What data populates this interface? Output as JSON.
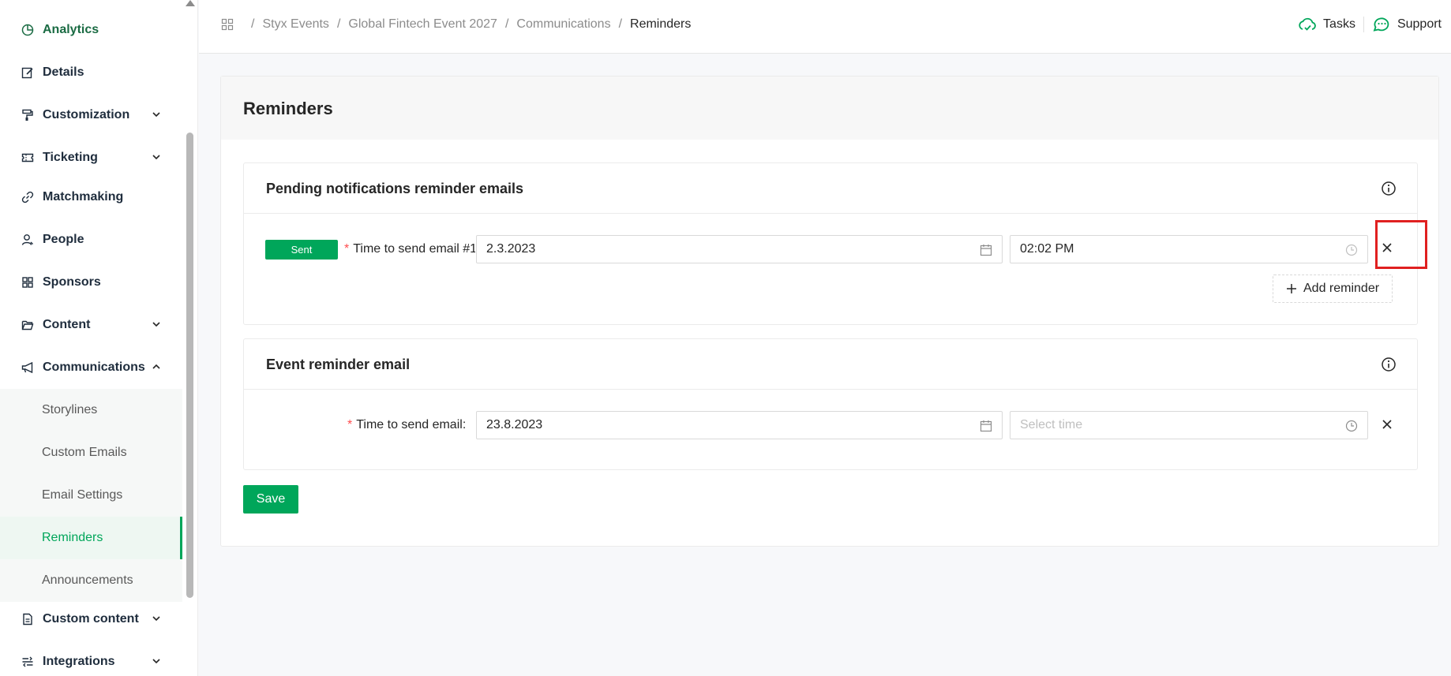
{
  "sidebar": {
    "items": [
      {
        "label": "Analytics",
        "icon": "pie-chart-icon"
      },
      {
        "label": "Details",
        "icon": "edit-icon"
      },
      {
        "label": "Customization",
        "icon": "paint-roller-icon"
      },
      {
        "label": "Ticketing",
        "icon": "ticket-icon"
      },
      {
        "label": "Matchmaking",
        "icon": "link-icon"
      },
      {
        "label": "People",
        "icon": "person-icon"
      },
      {
        "label": "Sponsors",
        "icon": "grid-icon"
      },
      {
        "label": "Content",
        "icon": "folder-icon"
      },
      {
        "label": "Communications",
        "icon": "megaphone-icon"
      },
      {
        "label": "Custom content",
        "icon": "document-icon"
      },
      {
        "label": "Integrations",
        "icon": "integrations-icon"
      }
    ],
    "sub_items": [
      {
        "label": "Storylines"
      },
      {
        "label": "Custom Emails"
      },
      {
        "label": "Email Settings"
      },
      {
        "label": "Reminders"
      },
      {
        "label": "Announcements"
      }
    ]
  },
  "breadcrumb": [
    "Styx Events",
    "Global Fintech Event 2027",
    "Communications",
    "Reminders"
  ],
  "top_actions": {
    "tasks": "Tasks",
    "support": "Support"
  },
  "page": {
    "title": "Reminders",
    "pending": {
      "title": "Pending notifications reminder emails",
      "badge": "Sent",
      "label": "Time to send email #1",
      "date": "2.3.2023",
      "time": "02:02 PM",
      "add_label": "Add reminder"
    },
    "event": {
      "title": "Event reminder email",
      "label": "Time to send email",
      "colon": ":",
      "date": "23.8.2023",
      "time_placeholder": "Select time"
    },
    "save_label": "Save"
  },
  "colors": {
    "accent": "#00a65a",
    "highlight": "#e02020"
  }
}
